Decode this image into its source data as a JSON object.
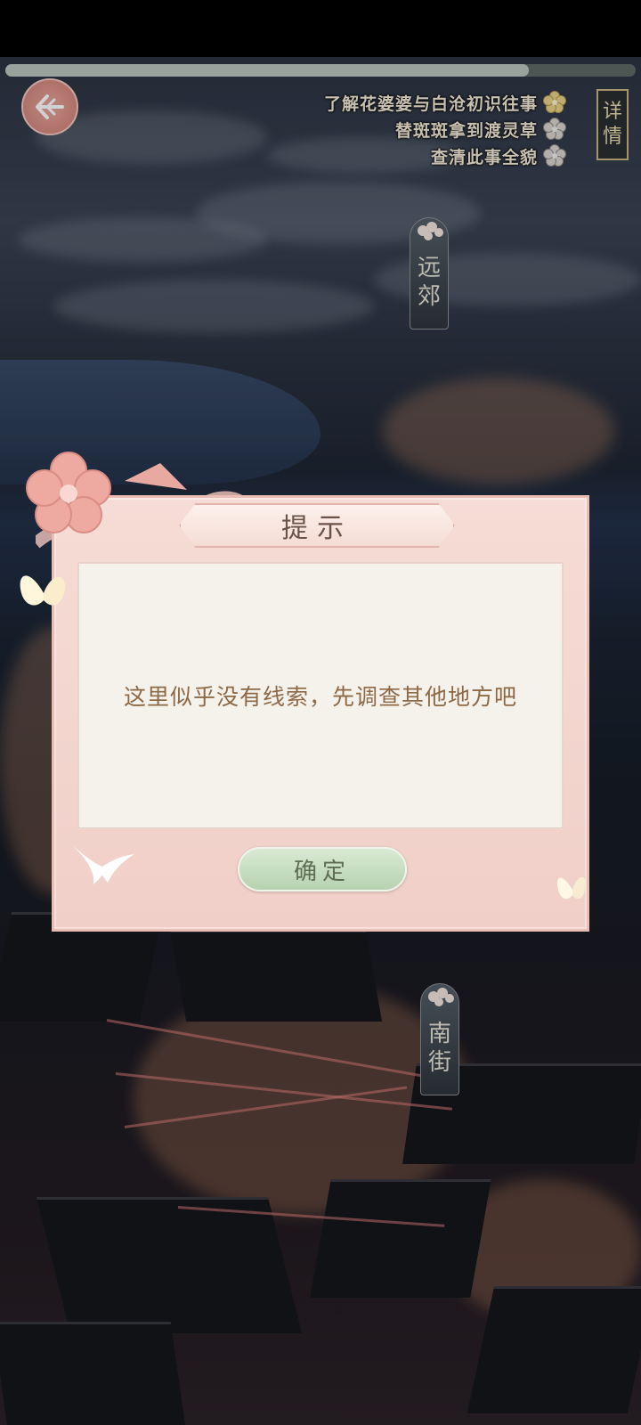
{
  "progress": {
    "fraction": 0.83
  },
  "tasks": [
    {
      "text": "了解花婆婆与白沧初识往事",
      "icon": "flower-gold-icon",
      "done": true
    },
    {
      "text": "替斑斑拿到渡灵草",
      "icon": "flower-gray-icon",
      "done": false
    },
    {
      "text": "查清此事全貌",
      "icon": "flower-gray-icon",
      "done": false
    }
  ],
  "detail_button": {
    "line1": "详",
    "line2": "情"
  },
  "locations": {
    "outskirts": {
      "line1": "远",
      "line2": "郊"
    },
    "south_street": {
      "line1": "南",
      "line2": "街"
    }
  },
  "dialog": {
    "title": "提示",
    "message": "这里似乎没有线索，先调查其他地方吧",
    "confirm_label": "确定"
  },
  "colors": {
    "dialog_bg": "#f6dcd6",
    "confirm_bg": "#b7d2b0",
    "gold_flower": "#e8d28a",
    "gray_flower": "#d9d6d0"
  }
}
